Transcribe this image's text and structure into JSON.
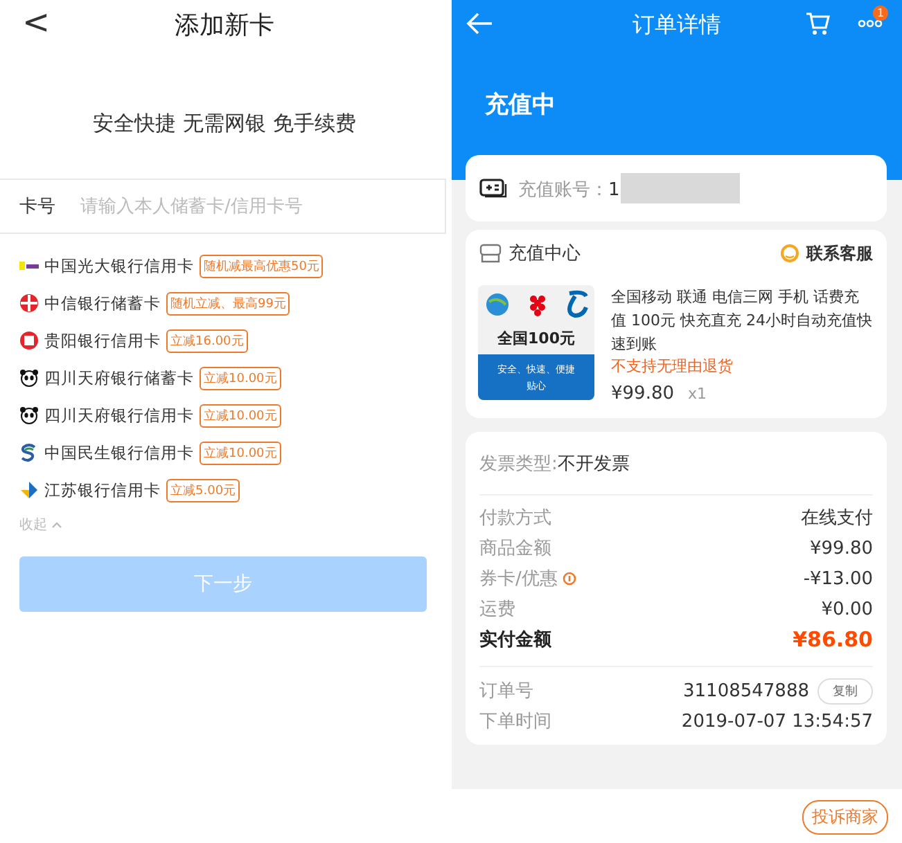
{
  "add_card": {
    "title": "添加新卡",
    "back": "<",
    "slogan": "安全快捷 无需网银 免手续费",
    "card_field": {
      "label": "卡号",
      "placeholder": "请输入本人储蓄卡/信用卡号"
    },
    "banks": [
      {
        "name": "中国光大银行信用卡",
        "promo": "随机减最高优惠50元",
        "kind": "everbright"
      },
      {
        "name": "中信银行储蓄卡",
        "promo": "随机立减、最高99元",
        "kind": "citic"
      },
      {
        "name": "贵阳银行信用卡",
        "promo": "立减16.00元",
        "kind": "guiyang"
      },
      {
        "name": "四川天府银行储蓄卡",
        "promo": "立减10.00元",
        "kind": "panda"
      },
      {
        "name": "四川天府银行信用卡",
        "promo": "立减10.00元",
        "kind": "panda"
      },
      {
        "name": "中国民生银行信用卡",
        "promo": "立减10.00元",
        "kind": "minsheng"
      },
      {
        "name": "江苏银行信用卡",
        "promo": "立减5.00元",
        "kind": "jiangsu"
      }
    ],
    "collapse": "收起",
    "next_button": {
      "label": "下一步",
      "disabled": true
    }
  },
  "order": {
    "title": "订单详情",
    "badge": "1",
    "status": "充值中",
    "account_label": "充值账号：",
    "account_value": "1",
    "shop": {
      "name": "充值中心",
      "contact": "联系客服"
    },
    "product": {
      "image_title": "全国100元",
      "image_banner": "安全、快速、便捷",
      "image_sub": "贴心",
      "description": "全国移动 联通 电信三网 手机 话费充值 100元 快充直充 24小时自动充值快速到账",
      "notice": "不支持无理由退货",
      "price": "¥99.80",
      "qty": "x1"
    },
    "invoice_label": "发票类型:",
    "invoice_value": "不开发票",
    "payment_rows": [
      {
        "label": "付款方式",
        "value": "在线支付",
        "kind": "plain"
      },
      {
        "label": "商品金额",
        "value": "¥99.80",
        "kind": "plain"
      },
      {
        "label": "券卡/优惠",
        "value": "-¥13.00",
        "kind": "info"
      },
      {
        "label": "运费",
        "value": "¥0.00",
        "kind": "plain"
      },
      {
        "label": "实付金额",
        "value": "¥86.80",
        "kind": "total"
      }
    ],
    "order_rows": [
      {
        "label": "订单号",
        "value": "31108547888",
        "action": "复制"
      },
      {
        "label": "下单时间",
        "value": "2019-07-07 13:54:57"
      }
    ],
    "complain_button": "投诉商家"
  }
}
